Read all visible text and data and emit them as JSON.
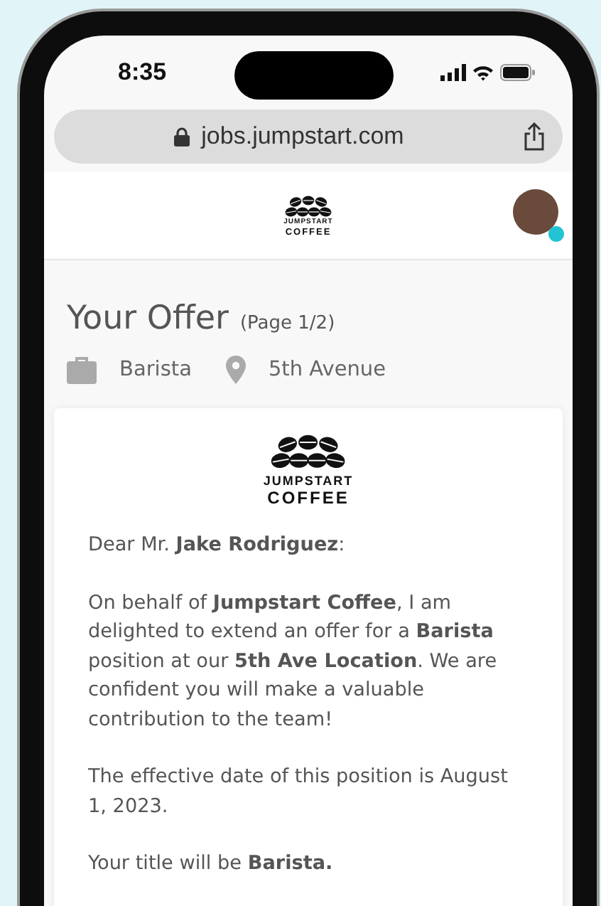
{
  "status_bar": {
    "time": "8:35"
  },
  "browser": {
    "url": "jobs.jumpstart.com"
  },
  "header": {
    "logo": {
      "line_1": "JUMPSTART",
      "line_2": "COFFEE"
    }
  },
  "offer": {
    "title": "Your Offer",
    "page": "(Page 1/2)",
    "meta": [
      {
        "kind": "job",
        "text": "Barista"
      },
      {
        "kind": "location",
        "text": "5th Avenue"
      }
    ]
  },
  "letter": {
    "logo": {
      "line_1": "JUMPSTART",
      "line_2": "COFFEE"
    },
    "paragraphs": [
      "Dear Mr. **Jake Rodriguez**:",
      "On behalf of **Jumpstart Coffee**, I am delighted to extend an offer for a **Barista** position at our **5th Ave Location**. We are confident you will make a valuable contribution to the team!",
      "The effective date of this position is August 1, 2023.",
      "Your title will be **Barista.**"
    ]
  }
}
